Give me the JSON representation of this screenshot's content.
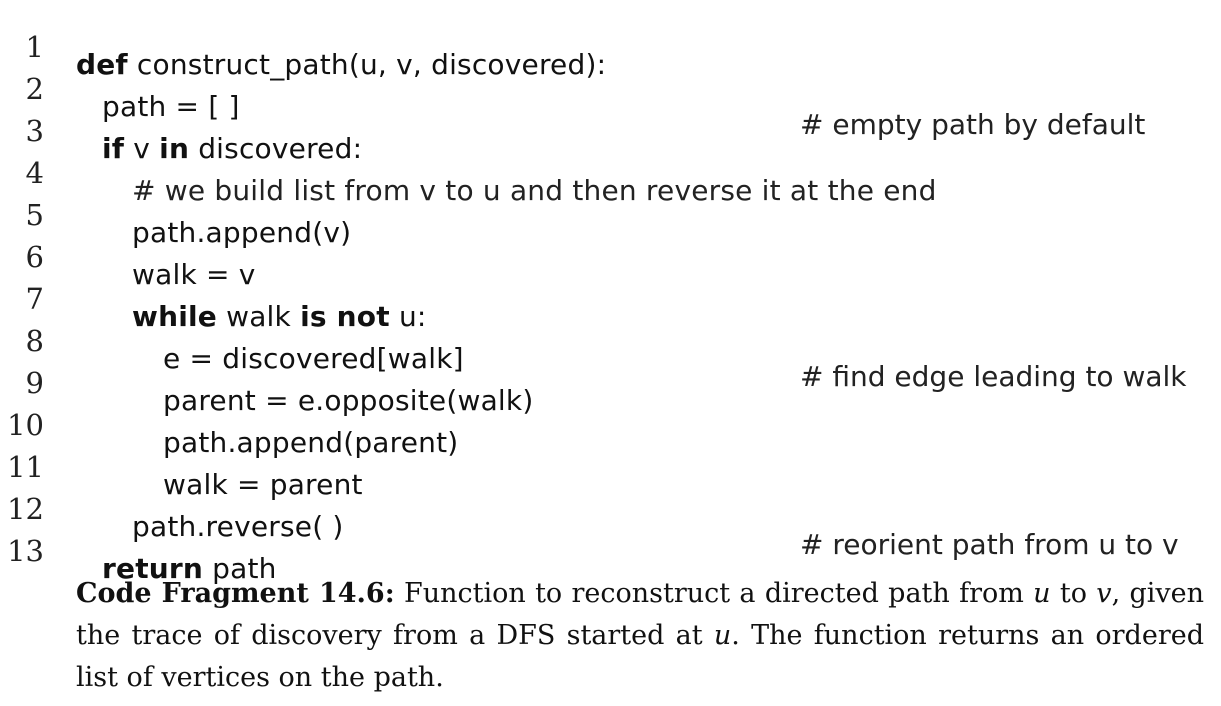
{
  "code_lines": [
    {
      "number": "1",
      "parts": [
        "def",
        " construct_path(u, v, discovered):"
      ],
      "comment": ""
    },
    {
      "number": "2",
      "parts": [
        "path = [ ]"
      ],
      "comment": "# empty path by default"
    },
    {
      "number": "3",
      "parts": [
        "if",
        " v ",
        "in",
        " discovered:"
      ],
      "comment": ""
    },
    {
      "number": "4",
      "parts": [
        "# we build list from v to u and then reverse it at the end"
      ],
      "comment": ""
    },
    {
      "number": "5",
      "parts": [
        "path.append(v)"
      ],
      "comment": ""
    },
    {
      "number": "6",
      "parts": [
        "walk = v"
      ],
      "comment": ""
    },
    {
      "number": "7",
      "parts": [
        "while",
        " walk ",
        "is not",
        " u:"
      ],
      "comment": ""
    },
    {
      "number": "8",
      "parts": [
        "e = discovered[walk]"
      ],
      "comment": "# find edge leading to walk"
    },
    {
      "number": "9",
      "parts": [
        "parent = e.opposite(walk)"
      ],
      "comment": ""
    },
    {
      "number": "10",
      "parts": [
        "path.append(parent)"
      ],
      "comment": ""
    },
    {
      "number": "11",
      "parts": [
        "walk = parent"
      ],
      "comment": ""
    },
    {
      "number": "12",
      "parts": [
        "path.reverse( )"
      ],
      "comment": "# reorient path from u to v"
    },
    {
      "number": "13",
      "parts": [
        "return",
        " path"
      ],
      "comment": ""
    }
  ],
  "caption": {
    "label": "Code Fragment 14.6:",
    "t1": " Function to reconstruct a directed path from ",
    "u1": "u",
    "t2": " to ",
    "v1": "v",
    "t3": ", given the trace of discovery from a DFS started at ",
    "u2": "u",
    "t4": ". The function returns an ordered list of vertices on the path."
  }
}
